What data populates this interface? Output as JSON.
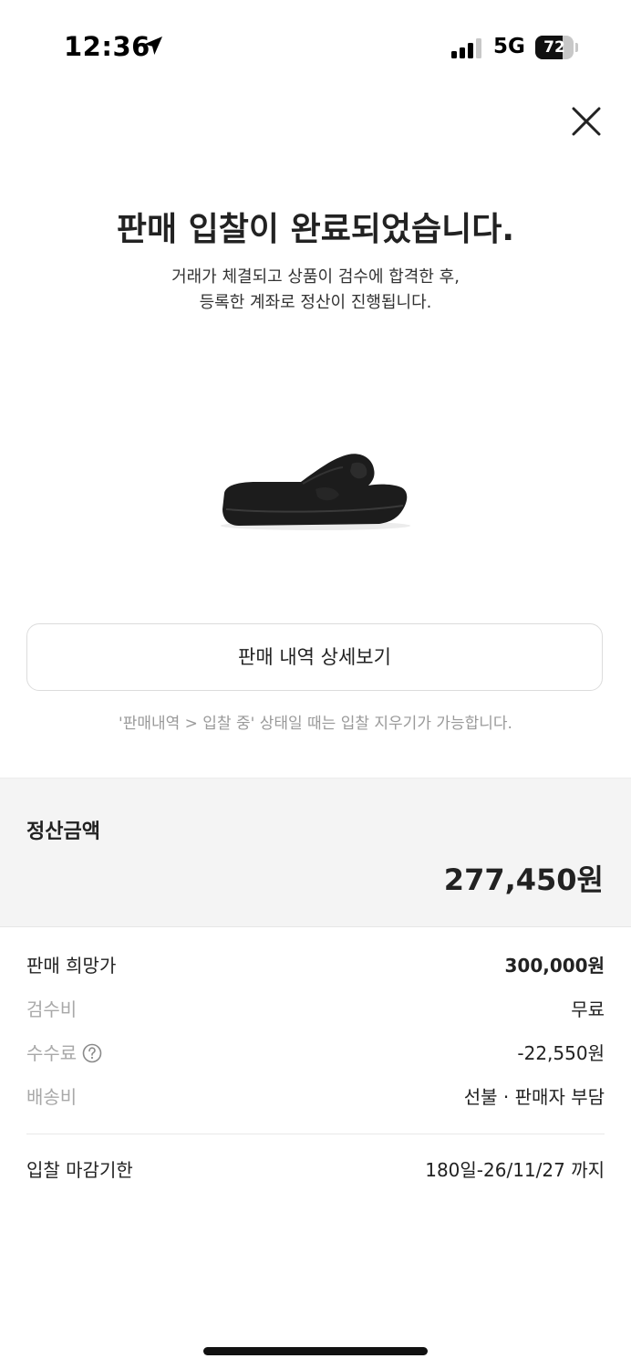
{
  "status_bar": {
    "time": "12:36",
    "network": "5G",
    "battery": "72",
    "battery_level": 0.72
  },
  "header": {
    "title": "판매 입찰이 완료되었습니다.",
    "subtitle_line1": "거래가 체결되고 상품이 검수에 합격한 후,",
    "subtitle_line2": "등록한 계좌로 정산이 진행됩니다."
  },
  "product": {
    "icon": "black-slide-sandal-image"
  },
  "detail_button": {
    "label": "판매 내역 상세보기"
  },
  "hint": "'판매내역 > 입찰 중' 상태일 때는 입찰 지우기가 가능합니다.",
  "settlement": {
    "label": "정산금액",
    "amount": "277,450원"
  },
  "fees": {
    "desired_price_label": "판매 희망가",
    "desired_price_value": "300,000원",
    "inspection_label": "검수비",
    "inspection_value": "무료",
    "commission_label": "수수료",
    "commission_value": "-22,550원",
    "shipping_label": "배송비",
    "shipping_value": "선불 · 판매자 부담"
  },
  "deadline": {
    "label": "입찰 마감기한",
    "value": "180일-26/11/27 까지"
  },
  "colors": {
    "text": "#222222",
    "muted": "#a8a8a8",
    "panel": "#f4f4f4"
  }
}
